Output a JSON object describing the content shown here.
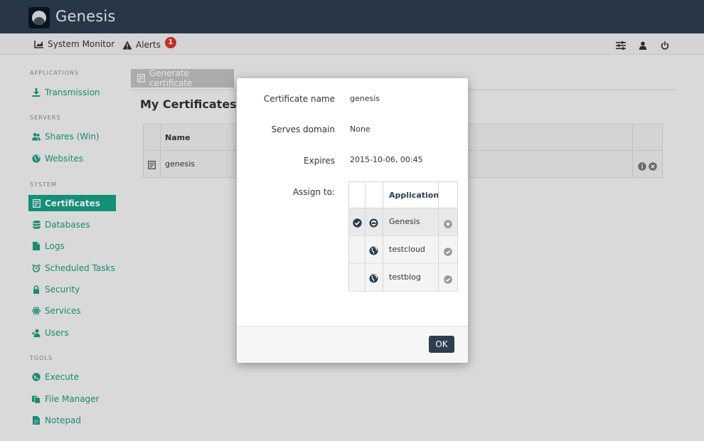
{
  "app": {
    "title": "Genesis"
  },
  "subbar": {
    "system_monitor": "System Monitor",
    "alerts": "Alerts",
    "alert_count": "1"
  },
  "sidebar": {
    "sections": [
      {
        "label": "APPLICATIONS"
      },
      {
        "label": "SERVERS"
      },
      {
        "label": "SYSTEM"
      },
      {
        "label": "TOOLS"
      }
    ],
    "items": [
      {
        "label": "Transmission",
        "icon": "download-icon"
      },
      {
        "label": "Shares (Win)",
        "icon": "users-icon"
      },
      {
        "label": "Websites",
        "icon": "globe-icon"
      },
      {
        "label": "Certificates",
        "icon": "certificate-icon",
        "active": true
      },
      {
        "label": "Databases",
        "icon": "database-icon"
      },
      {
        "label": "Logs",
        "icon": "file-icon"
      },
      {
        "label": "Scheduled Tasks",
        "icon": "alarm-clock-icon"
      },
      {
        "label": "Security",
        "icon": "lock-icon"
      },
      {
        "label": "Services",
        "icon": "atom-icon"
      },
      {
        "label": "Users",
        "icon": "user-icon"
      },
      {
        "label": "Execute",
        "icon": "execute-icon"
      },
      {
        "label": "File Manager",
        "icon": "files-icon"
      },
      {
        "label": "Notepad",
        "icon": "notepad-icon"
      }
    ]
  },
  "main": {
    "generate_button": "Generate certificate",
    "title": "My Certificates",
    "table": {
      "col_name": "Name",
      "rows": [
        {
          "name": "genesis"
        }
      ]
    }
  },
  "modal": {
    "cert_name_label": "Certificate name",
    "cert_name_value": "genesis",
    "domain_label": "Serves domain",
    "domain_value": "None",
    "expires_label": "Expires",
    "expires_value": "2015-10-06, 00:45",
    "assign_label": "Assign to:",
    "assign_header": "Application",
    "apps": [
      {
        "name": "Genesis",
        "assigned": true
      },
      {
        "name": "testcloud",
        "assigned": false
      },
      {
        "name": "testblog",
        "assigned": false
      }
    ],
    "ok_button": "OK"
  },
  "colors": {
    "topbar": "#2c3e50",
    "accent": "#17a086",
    "badge": "#d9342b",
    "button": "#2c3e50"
  }
}
